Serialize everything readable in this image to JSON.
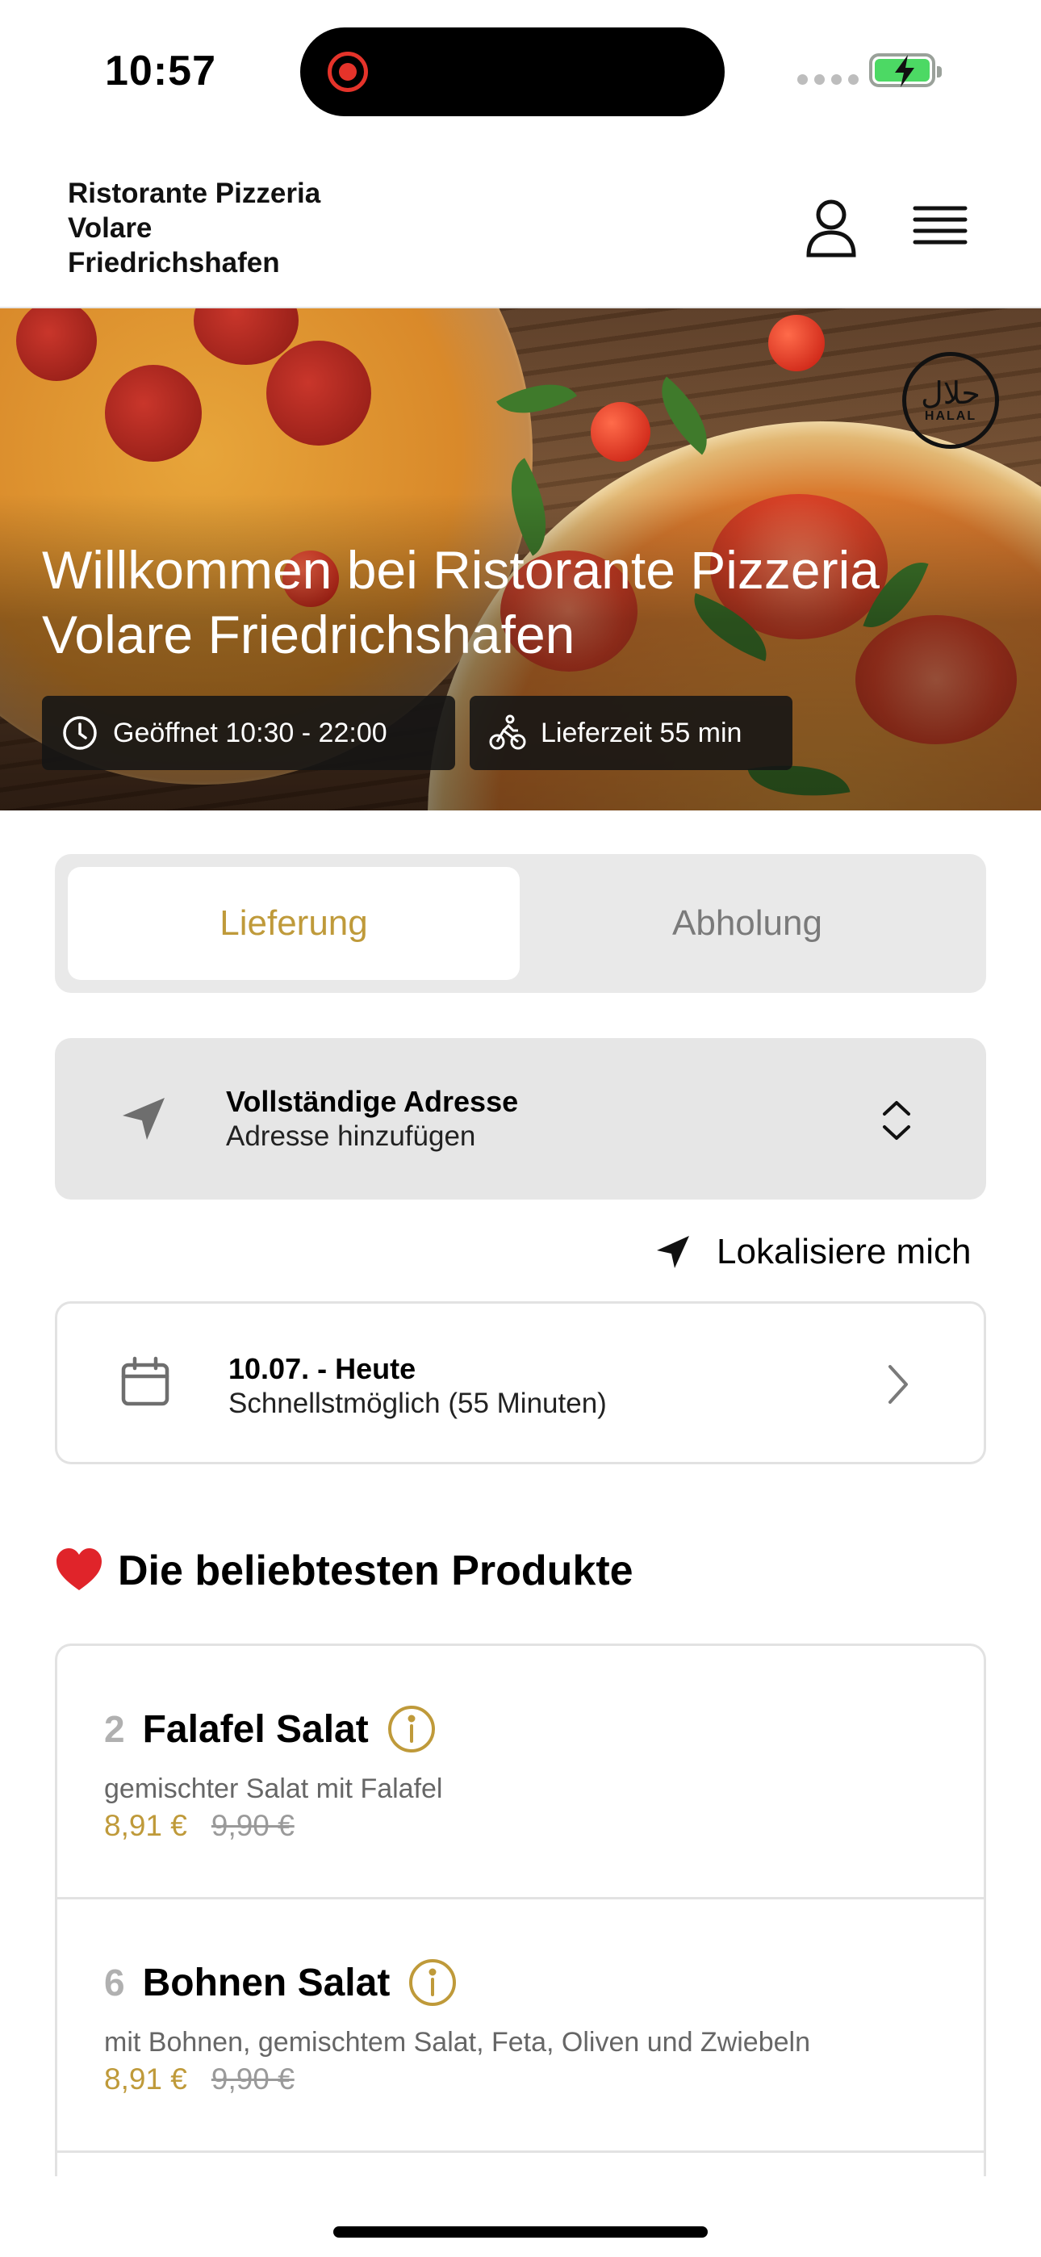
{
  "status_bar": {
    "time": "10:57"
  },
  "header": {
    "restaurant_name_line1": "Ristorante Pizzeria",
    "restaurant_name_line2": "Volare",
    "restaurant_name_line3": "Friedrichshafen",
    "icons": [
      "user-icon",
      "menu-icon"
    ]
  },
  "hero": {
    "title": "Willkommen bei Ristorante Pizzeria Volare Friedrichshafen",
    "halal_ar": "حلال",
    "halal_en": "HALAL",
    "open_hours": "Geöffnet 10:30 - 22:00",
    "delivery_time": "Lieferzeit 55 min"
  },
  "order_mode": {
    "delivery_label": "Lieferung",
    "pickup_label": "Abholung",
    "selected": "Lieferung"
  },
  "address": {
    "title": "Vollständige Adresse",
    "subtitle": "Adresse hinzufügen"
  },
  "locate_label": "Lokalisiere mich",
  "schedule": {
    "title": "10.07. - Heute",
    "subtitle": "Schnellstmöglich (55 Minuten)"
  },
  "popular": {
    "title": "Die beliebtesten Produkte",
    "items": [
      {
        "number": "2",
        "name": "Falafel Salat",
        "description": "gemischter Salat mit Falafel",
        "price": "8,91 €",
        "old_price": "9,90 €"
      },
      {
        "number": "6",
        "name": "Bohnen Salat",
        "description": "mit Bohnen, gemischtem Salat, Feta, Oliven und Zwiebeln",
        "price": "8,91 €",
        "old_price": "9,90 €"
      }
    ]
  },
  "colors": {
    "accent": "#bf9a3a",
    "muted": "#7a7a7a",
    "card_bg": "#e6e6e6"
  }
}
